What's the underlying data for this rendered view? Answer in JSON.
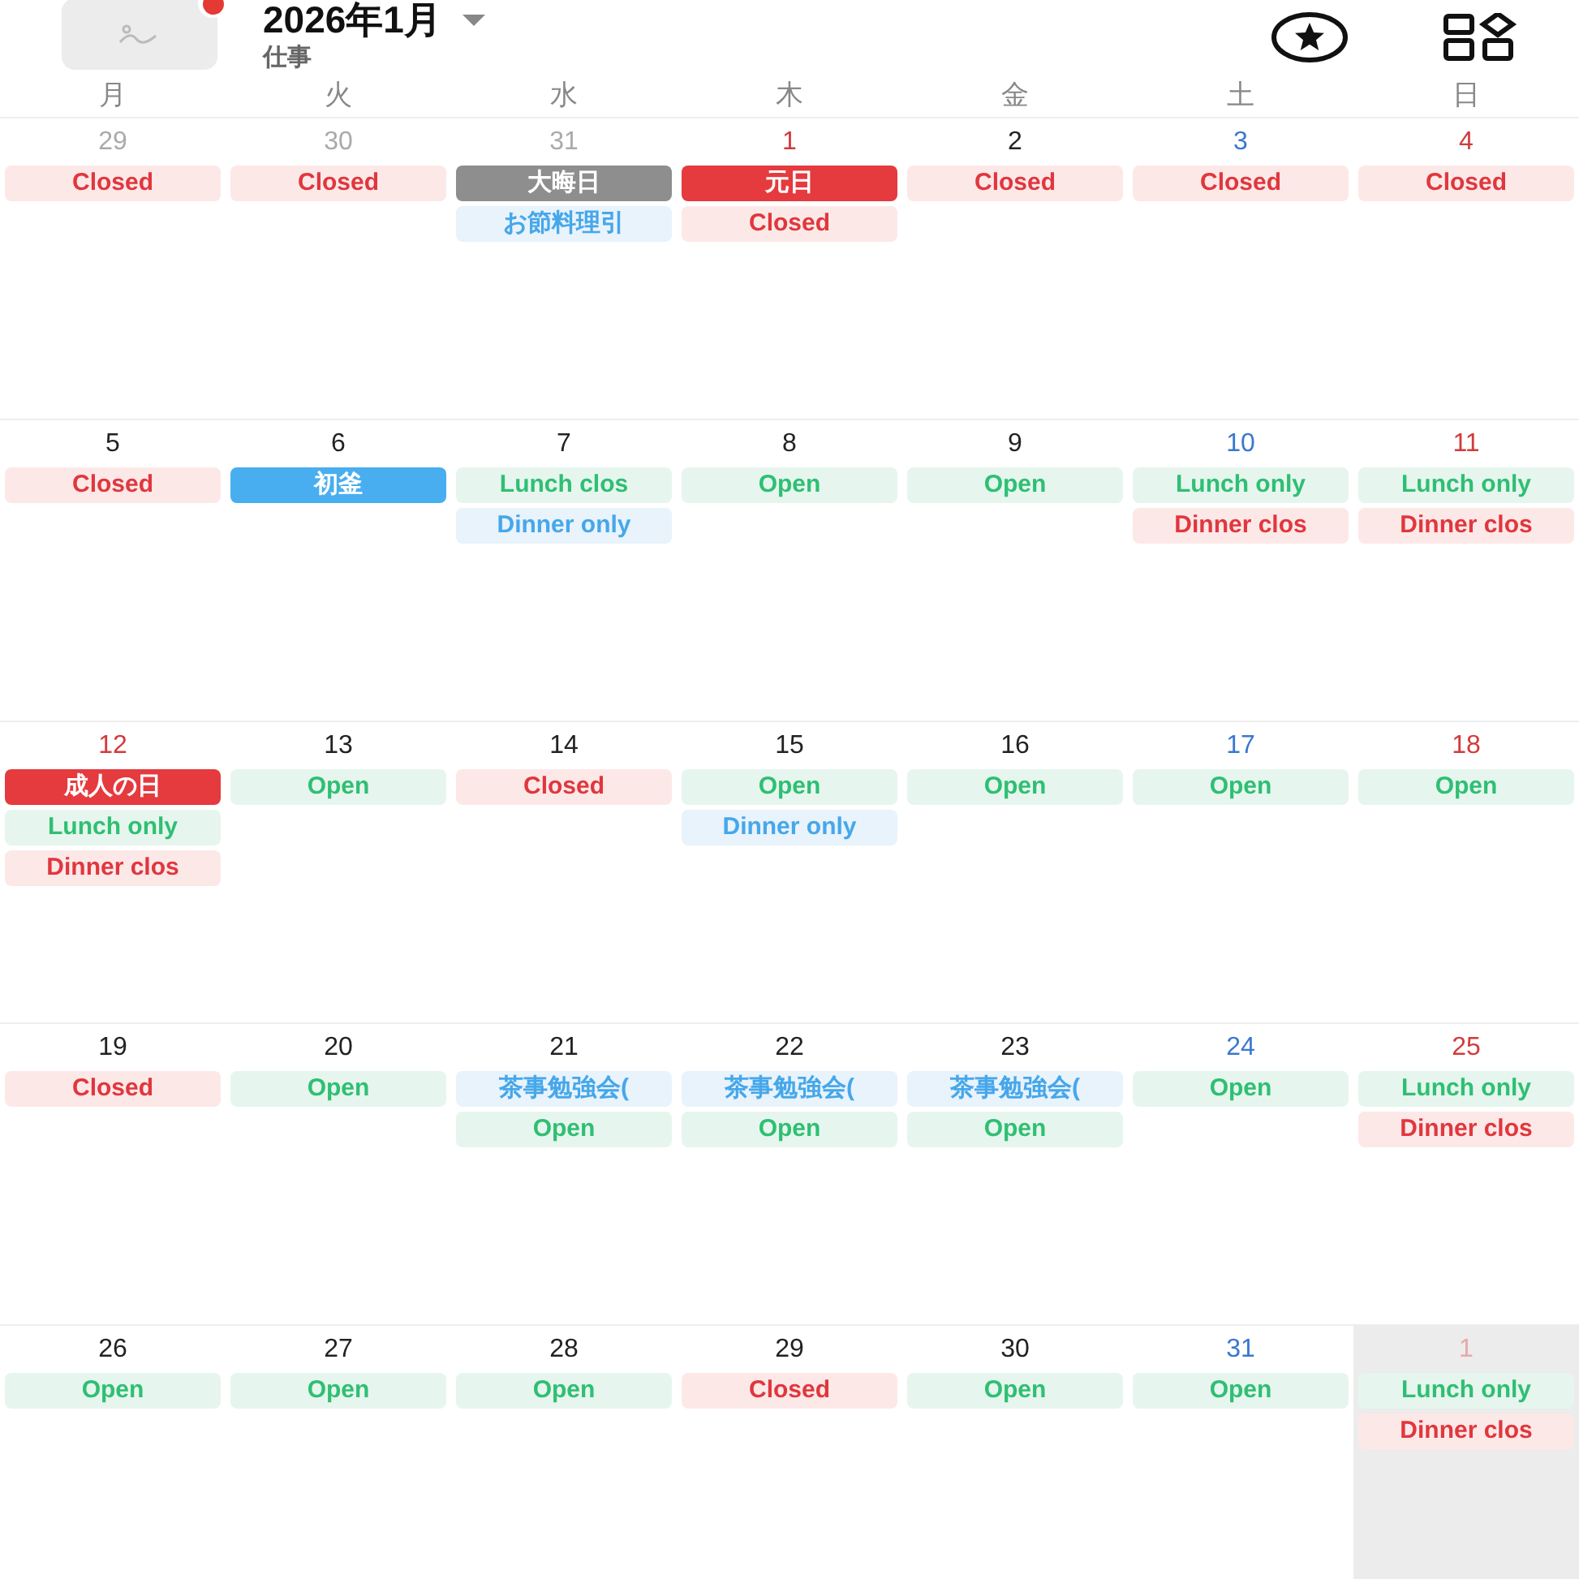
{
  "header": {
    "title": "2026年1月",
    "subtitle": "仕事",
    "has_notification": true
  },
  "weekdays": [
    "月",
    "火",
    "水",
    "木",
    "金",
    "土",
    "日"
  ],
  "weeks": [
    [
      {
        "date": "29",
        "kind": "muted",
        "selected": false,
        "events": [
          {
            "label": "Closed",
            "kind": "closed"
          }
        ]
      },
      {
        "date": "30",
        "kind": "muted",
        "selected": false,
        "events": [
          {
            "label": "Closed",
            "kind": "closed"
          }
        ]
      },
      {
        "date": "31",
        "kind": "muted",
        "selected": false,
        "events": [
          {
            "label": "大晦日",
            "kind": "past"
          },
          {
            "label": "お節料理引",
            "kind": "info"
          }
        ]
      },
      {
        "date": "1",
        "kind": "holiday",
        "selected": false,
        "events": [
          {
            "label": "元日",
            "kind": "holiday"
          },
          {
            "label": "Closed",
            "kind": "closed"
          }
        ]
      },
      {
        "date": "2",
        "kind": "normal",
        "selected": false,
        "events": [
          {
            "label": "Closed",
            "kind": "closed"
          }
        ]
      },
      {
        "date": "3",
        "kind": "saturday",
        "selected": false,
        "events": [
          {
            "label": "Closed",
            "kind": "closed"
          }
        ]
      },
      {
        "date": "4",
        "kind": "holiday",
        "selected": false,
        "events": [
          {
            "label": "Closed",
            "kind": "closed"
          }
        ]
      }
    ],
    [
      {
        "date": "5",
        "kind": "normal",
        "selected": false,
        "events": [
          {
            "label": "Closed",
            "kind": "closed"
          }
        ]
      },
      {
        "date": "6",
        "kind": "normal",
        "selected": false,
        "events": [
          {
            "label": "初釜",
            "kind": "special"
          }
        ]
      },
      {
        "date": "7",
        "kind": "normal",
        "selected": false,
        "events": [
          {
            "label": "Lunch clos",
            "kind": "open"
          },
          {
            "label": "Dinner only",
            "kind": "info"
          }
        ]
      },
      {
        "date": "8",
        "kind": "normal",
        "selected": false,
        "events": [
          {
            "label": "Open",
            "kind": "open"
          }
        ]
      },
      {
        "date": "9",
        "kind": "normal",
        "selected": false,
        "events": [
          {
            "label": "Open",
            "kind": "open"
          }
        ]
      },
      {
        "date": "10",
        "kind": "saturday",
        "selected": false,
        "events": [
          {
            "label": "Lunch only",
            "kind": "open"
          },
          {
            "label": "Dinner clos",
            "kind": "closed"
          }
        ]
      },
      {
        "date": "11",
        "kind": "holiday",
        "selected": false,
        "events": [
          {
            "label": "Lunch only",
            "kind": "open"
          },
          {
            "label": "Dinner clos",
            "kind": "closed"
          }
        ]
      }
    ],
    [
      {
        "date": "12",
        "kind": "holiday",
        "selected": false,
        "events": [
          {
            "label": "成人の日",
            "kind": "holiday"
          },
          {
            "label": "Lunch only",
            "kind": "open"
          },
          {
            "label": "Dinner clos",
            "kind": "closed"
          }
        ]
      },
      {
        "date": "13",
        "kind": "normal",
        "selected": false,
        "events": [
          {
            "label": "Open",
            "kind": "open"
          }
        ]
      },
      {
        "date": "14",
        "kind": "normal",
        "selected": false,
        "events": [
          {
            "label": "Closed",
            "kind": "closed"
          }
        ]
      },
      {
        "date": "15",
        "kind": "normal",
        "selected": false,
        "events": [
          {
            "label": "Open",
            "kind": "open"
          },
          {
            "label": "Dinner only",
            "kind": "info"
          }
        ]
      },
      {
        "date": "16",
        "kind": "normal",
        "selected": false,
        "events": [
          {
            "label": "Open",
            "kind": "open"
          }
        ]
      },
      {
        "date": "17",
        "kind": "saturday",
        "selected": false,
        "events": [
          {
            "label": "Open",
            "kind": "open"
          }
        ]
      },
      {
        "date": "18",
        "kind": "holiday",
        "selected": false,
        "events": [
          {
            "label": "Open",
            "kind": "open"
          }
        ]
      }
    ],
    [
      {
        "date": "19",
        "kind": "normal",
        "selected": false,
        "events": [
          {
            "label": "Closed",
            "kind": "closed"
          }
        ]
      },
      {
        "date": "20",
        "kind": "normal",
        "selected": false,
        "events": [
          {
            "label": "Open",
            "kind": "open"
          }
        ]
      },
      {
        "date": "21",
        "kind": "normal",
        "selected": false,
        "events": [
          {
            "label": "茶事勉強会(",
            "kind": "info"
          },
          {
            "label": "Open",
            "kind": "open"
          }
        ]
      },
      {
        "date": "22",
        "kind": "normal",
        "selected": false,
        "events": [
          {
            "label": "茶事勉強会(",
            "kind": "info"
          },
          {
            "label": "Open",
            "kind": "open"
          }
        ]
      },
      {
        "date": "23",
        "kind": "normal",
        "selected": false,
        "events": [
          {
            "label": "茶事勉強会(",
            "kind": "info"
          },
          {
            "label": "Open",
            "kind": "open"
          }
        ]
      },
      {
        "date": "24",
        "kind": "saturday",
        "selected": false,
        "events": [
          {
            "label": "Open",
            "kind": "open"
          }
        ]
      },
      {
        "date": "25",
        "kind": "holiday",
        "selected": false,
        "events": [
          {
            "label": "Lunch only",
            "kind": "open"
          },
          {
            "label": "Dinner clos",
            "kind": "closed"
          }
        ]
      }
    ],
    [
      {
        "date": "26",
        "kind": "normal",
        "selected": false,
        "events": [
          {
            "label": "Open",
            "kind": "open"
          }
        ]
      },
      {
        "date": "27",
        "kind": "normal",
        "selected": false,
        "events": [
          {
            "label": "Open",
            "kind": "open"
          }
        ]
      },
      {
        "date": "28",
        "kind": "normal",
        "selected": false,
        "events": [
          {
            "label": "Open",
            "kind": "open"
          }
        ]
      },
      {
        "date": "29",
        "kind": "normal",
        "selected": false,
        "events": [
          {
            "label": "Closed",
            "kind": "closed"
          }
        ]
      },
      {
        "date": "30",
        "kind": "normal",
        "selected": false,
        "events": [
          {
            "label": "Open",
            "kind": "open"
          }
        ]
      },
      {
        "date": "31",
        "kind": "saturday",
        "selected": false,
        "events": [
          {
            "label": "Open",
            "kind": "open"
          }
        ]
      },
      {
        "date": "1",
        "kind": "muted-holiday",
        "selected": true,
        "events": [
          {
            "label": "Lunch only",
            "kind": "open"
          },
          {
            "label": "Dinner clos",
            "kind": "closed"
          }
        ]
      }
    ]
  ]
}
